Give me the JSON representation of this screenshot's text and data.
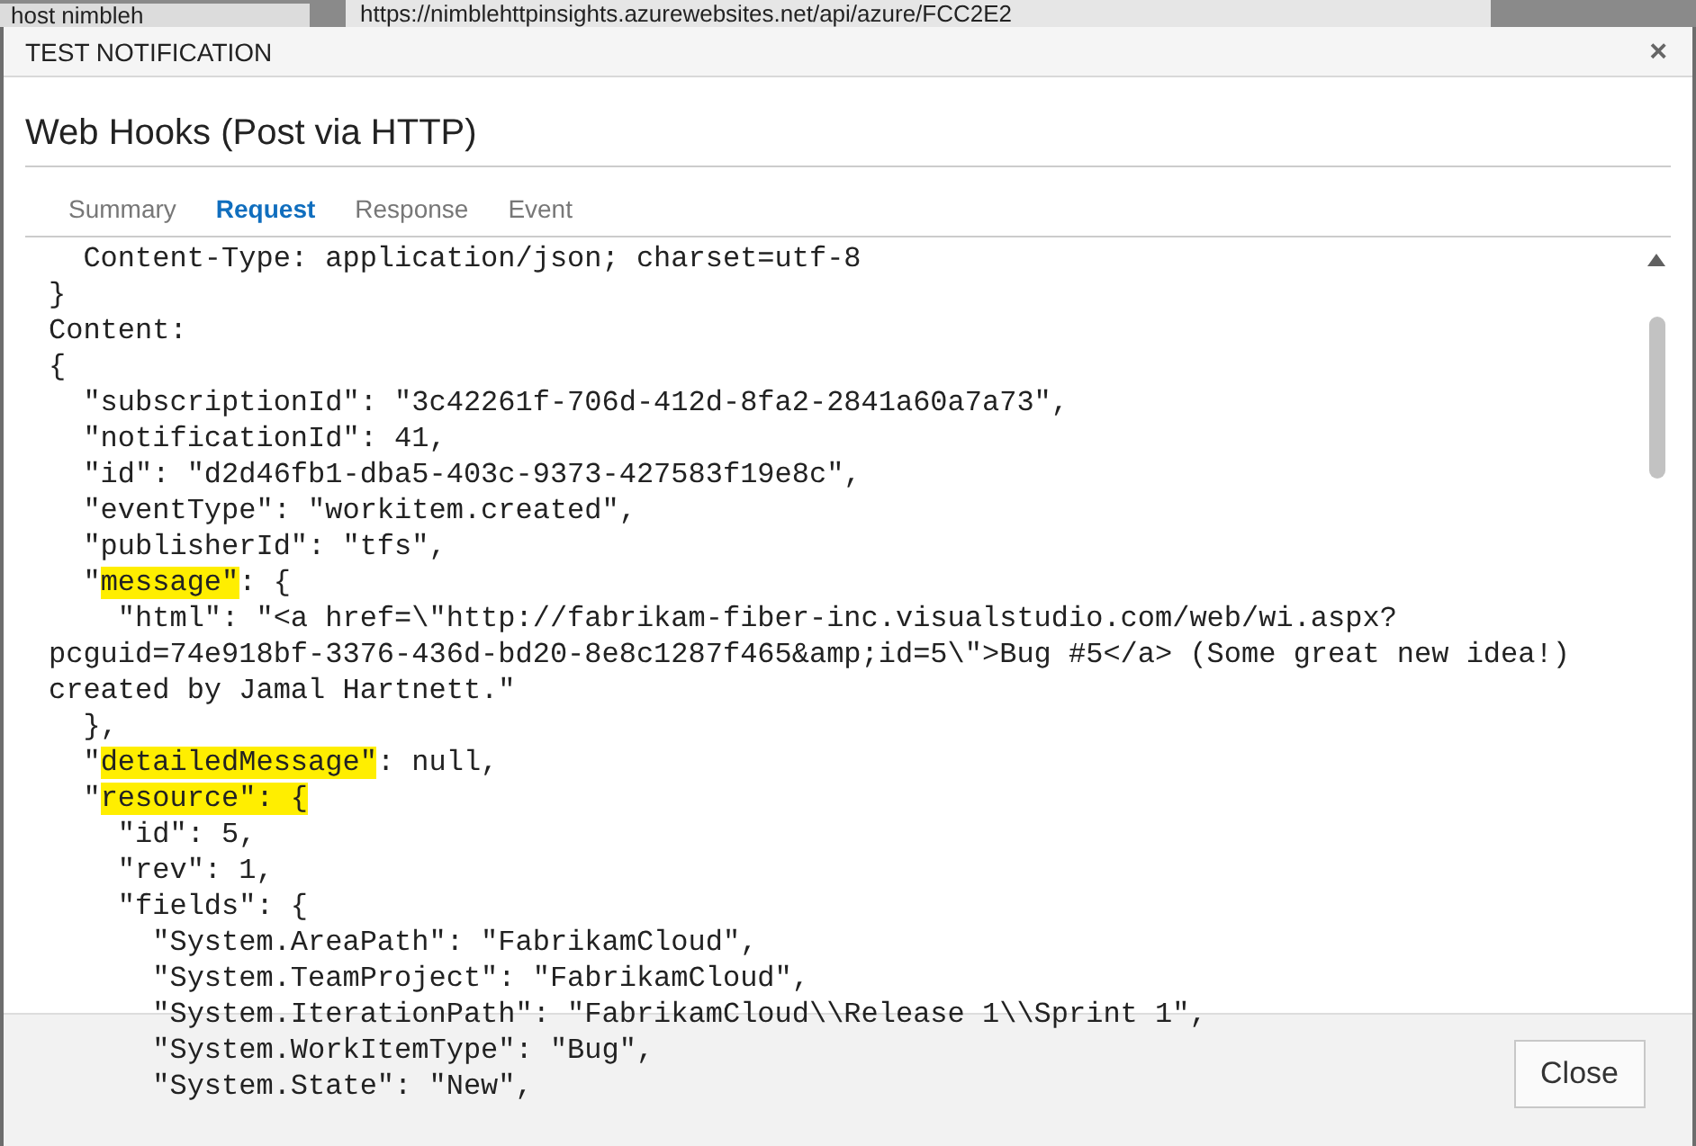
{
  "background": {
    "tab_label": "host nimbleh",
    "address": "https://nimblehttpinsights.azurewebsites.net/api/azure/FCC2E2"
  },
  "dialog": {
    "title": "TEST NOTIFICATION",
    "close_glyph": "×"
  },
  "heading": "Web Hooks (Post via HTTP)",
  "tabs": [
    {
      "label": "Summary",
      "selected": false
    },
    {
      "label": "Request",
      "selected": true
    },
    {
      "label": "Response",
      "selected": false
    },
    {
      "label": "Event",
      "selected": false
    }
  ],
  "code_lines": [
    [
      {
        "text": "  Content-Type: application/json; charset=utf-8",
        "highlighted": false
      }
    ],
    [
      {
        "text": "}",
        "highlighted": false
      }
    ],
    [
      {
        "text": "Content:",
        "highlighted": false
      }
    ],
    [
      {
        "text": "{",
        "highlighted": false
      }
    ],
    [
      {
        "text": "  \"subscriptionId\": \"3c42261f-706d-412d-8fa2-2841a60a7a73\",",
        "highlighted": false
      }
    ],
    [
      {
        "text": "  \"notificationId\": 41,",
        "highlighted": false
      }
    ],
    [
      {
        "text": "  \"id\": \"d2d46fb1-dba5-403c-9373-427583f19e8c\",",
        "highlighted": false
      }
    ],
    [
      {
        "text": "  \"eventType\": \"workitem.created\",",
        "highlighted": false
      }
    ],
    [
      {
        "text": "  \"publisherId\": \"tfs\",",
        "highlighted": false
      }
    ],
    [
      {
        "text": "  \"",
        "highlighted": false
      },
      {
        "text": "message\"",
        "highlighted": true
      },
      {
        "text": ": {",
        "highlighted": false
      }
    ],
    [
      {
        "text": "    \"html\": \"<a href=\\\"http://fabrikam-fiber-inc.visualstudio.com/web/wi.aspx?",
        "highlighted": false
      }
    ],
    [
      {
        "text": "pcguid=74e918bf-3376-436d-bd20-8e8c1287f465&amp;id=5\\\">Bug #5</a> (Some great new idea!)",
        "highlighted": false
      }
    ],
    [
      {
        "text": "created by Jamal Hartnett.\"",
        "highlighted": false
      }
    ],
    [
      {
        "text": "  },",
        "highlighted": false
      }
    ],
    [
      {
        "text": "  \"",
        "highlighted": false
      },
      {
        "text": "detailedMessage\"",
        "highlighted": true
      },
      {
        "text": ": null,",
        "highlighted": false
      }
    ],
    [
      {
        "text": "  \"",
        "highlighted": false
      },
      {
        "text": "resource\": {",
        "highlighted": true
      }
    ],
    [
      {
        "text": "    \"id\": 5,",
        "highlighted": false
      }
    ],
    [
      {
        "text": "    \"rev\": 1,",
        "highlighted": false
      }
    ],
    [
      {
        "text": "    \"fields\": {",
        "highlighted": false
      }
    ],
    [
      {
        "text": "      \"System.AreaPath\": \"FabrikamCloud\",",
        "highlighted": false
      }
    ],
    [
      {
        "text": "      \"System.TeamProject\": \"FabrikamCloud\",",
        "highlighted": false
      }
    ],
    [
      {
        "text": "      \"System.IterationPath\": \"FabrikamCloud\\\\Release 1\\\\Sprint 1\",",
        "highlighted": false
      }
    ],
    [
      {
        "text": "      \"System.WorkItemType\": \"Bug\",",
        "highlighted": false
      }
    ],
    [
      {
        "text": "      \"System.State\": \"New\",",
        "highlighted": false
      }
    ]
  ],
  "close_button": "Close"
}
